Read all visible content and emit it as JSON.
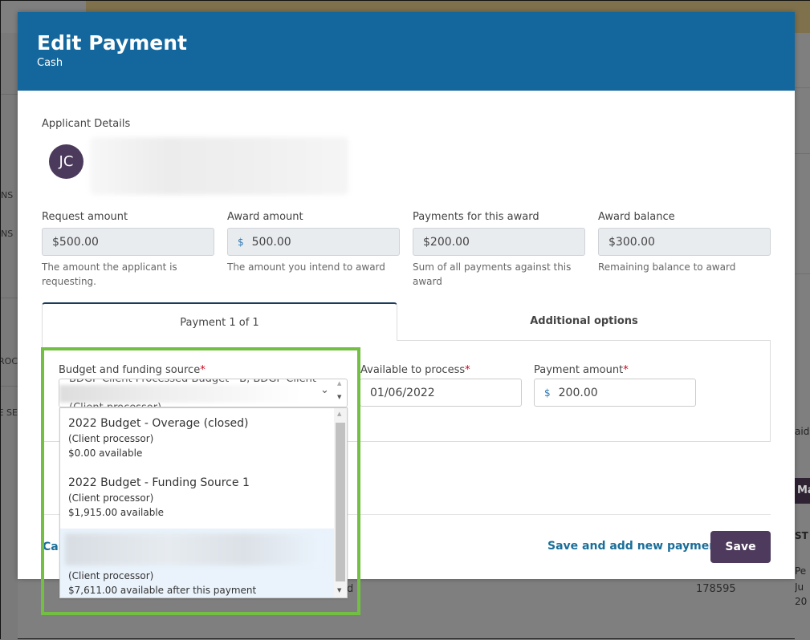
{
  "background": {
    "left_items": [
      "NS",
      "NS",
      "ROC",
      "E SE"
    ],
    "right_text": "aid",
    "right_header": "Ma",
    "right_col_header": "ST",
    "right_cell_lines": [
      "Pe",
      "Ju",
      "20"
    ],
    "row_number": "178595",
    "row_fragment": "d"
  },
  "modal": {
    "title": "Edit Payment",
    "subtitle": "Cash",
    "applicant_section_label": "Applicant Details",
    "applicant_initials": "JC",
    "summary_fields": [
      {
        "label": "Request amount",
        "value": "$500.00",
        "help": "The amount the applicant is requesting."
      },
      {
        "label": "Award amount",
        "currency": "$",
        "value": "500.00",
        "help": "The amount you intend to award"
      },
      {
        "label": "Payments for this award",
        "value": "$200.00",
        "help": "Sum of all payments against this award"
      },
      {
        "label": "Award balance",
        "value": "$300.00",
        "help": "Remaining balance to award"
      }
    ],
    "tabs": [
      {
        "label": "Payment 1 of 1",
        "active": true
      },
      {
        "label": "Additional options",
        "active": false
      }
    ],
    "payment": {
      "budget_label": "Budget and funding source",
      "budget_selected_top": "BDGP Client Processed Budget - B, BDGP Client",
      "budget_selected_bottom": "(Client processor)",
      "available_label": "Available to process",
      "available_value": "01/06/2022",
      "amount_label": "Payment amount",
      "amount_currency": "$",
      "amount_value": "200.00",
      "required_mark": "*"
    },
    "dropdown_options": [
      {
        "title": "2022 Budget - Overage (closed)",
        "processor": "(Client processor)",
        "available": "$0.00 available",
        "selected": false
      },
      {
        "title": "2022 Budget - Funding Source 1",
        "processor": "(Client processor)",
        "available": "$1,915.00 available",
        "selected": false
      },
      {
        "title": "",
        "processor": "(Client processor)",
        "available": "$7,611.00 available after this payment",
        "selected": true
      }
    ],
    "footer": {
      "cancel_label": "Cancel",
      "save_new_label": "Save and add new payment",
      "save_label": "Save"
    }
  },
  "icons": {
    "chevron": "⌄",
    "scroll_up": "▲",
    "scroll_down": "▼"
  },
  "colors": {
    "header_bg": "#14679c",
    "primary_button": "#4e3a5c",
    "link": "#1a6e99",
    "highlight": "#72bf44",
    "required": "#d0021b"
  }
}
